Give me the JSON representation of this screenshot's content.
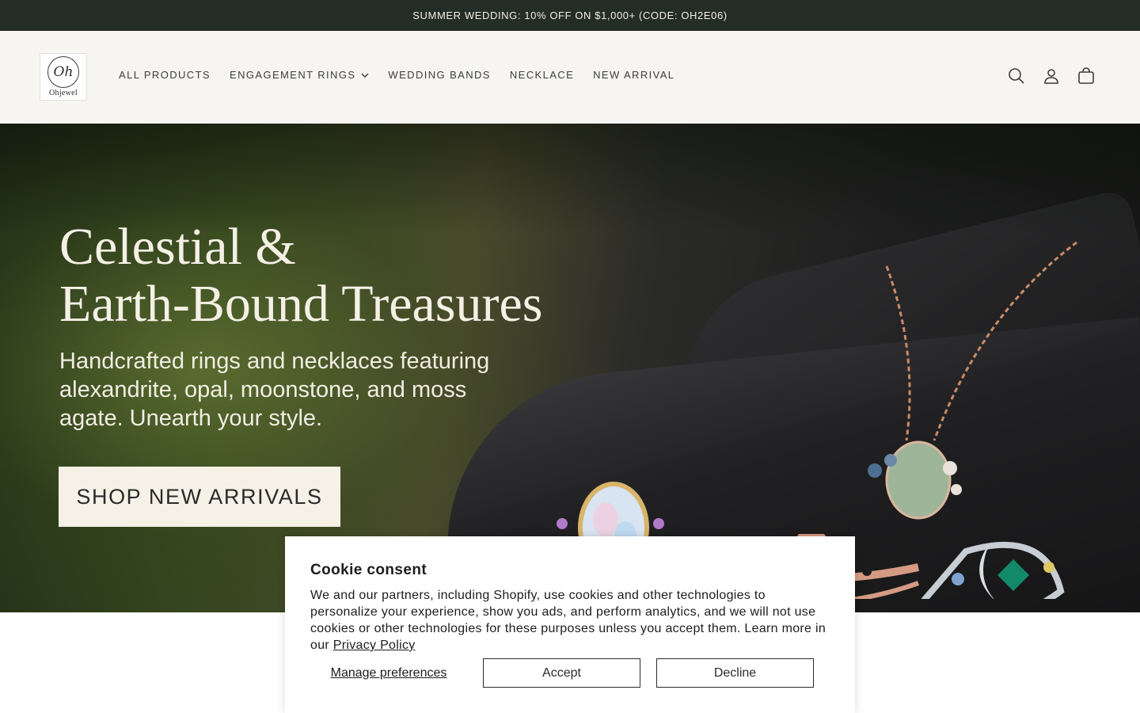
{
  "announcement": {
    "text": "SUMMER WEDDING: 10% OFF ON $1,000+ (CODE: OH2E06)"
  },
  "header": {
    "logo": {
      "mark": "Oh",
      "text": "Ohjewel"
    },
    "nav": [
      {
        "label": "ALL PRODUCTS",
        "has_dropdown": false
      },
      {
        "label": "ENGAGEMENT RINGS",
        "has_dropdown": true
      },
      {
        "label": "WEDDING BANDS",
        "has_dropdown": false
      },
      {
        "label": "NECKLACE",
        "has_dropdown": false
      },
      {
        "label": "NEW ARRIVAL",
        "has_dropdown": false
      }
    ],
    "icons": [
      "search-icon",
      "account-icon",
      "cart-icon"
    ]
  },
  "hero": {
    "title_line1": "Celestial &",
    "title_line2": "Earth-Bound Treasures",
    "subtitle": "Handcrafted rings and necklaces featuring alexandrite, opal, moonstone, and moss agate. Unearth your style.",
    "cta_label": "SHOP NEW ARRIVALS"
  },
  "cookie": {
    "title": "Cookie consent",
    "body": "We and our partners, including Shopify, use cookies and other technologies to personalize your experience, show you ads, and perform analytics, and we will not use cookies or other technologies for these purposes unless you accept them. Learn more in our",
    "link_label": "Privacy Policy",
    "manage_label": "Manage preferences",
    "accept_label": "Accept",
    "decline_label": "Decline"
  },
  "colors": {
    "announcement_bg": "#242e26",
    "header_bg": "#f6f5f2",
    "hero_button_bg": "#f5f1e7"
  }
}
